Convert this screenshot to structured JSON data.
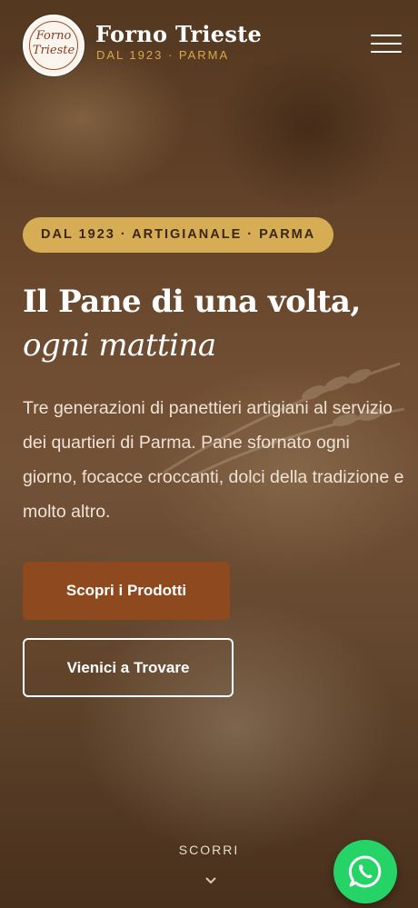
{
  "header": {
    "logo_line1": "Forno",
    "logo_line2": "Trieste",
    "brand_name": "Forno Trieste",
    "brand_subtitle": "DAL 1923 · PARMA",
    "menu_icon": "hamburger-menu-icon"
  },
  "hero": {
    "badge": "DAL 1923 · ARTIGIANALE · PARMA",
    "title_line1": "Il Pane di una volta,",
    "title_line2": "ogni mattina",
    "description": "Tre generazioni di panettieri artigiani al servizio dei quartieri di Parma. Pane sfornato ogni giorno, focacce croccanti, dolci della tradizione e molto altro.",
    "primary_button": "Scopri i Prodotti",
    "secondary_button": "Vienici a Trovare",
    "scroll_label": "SCORRI",
    "scroll_icon": "chevron-down-icon"
  },
  "floating": {
    "whatsapp_icon": "whatsapp-icon"
  },
  "colors": {
    "accent_gold": "#d6ad54",
    "primary_brown": "#8e4a1e",
    "whatsapp_green": "#25d366"
  }
}
